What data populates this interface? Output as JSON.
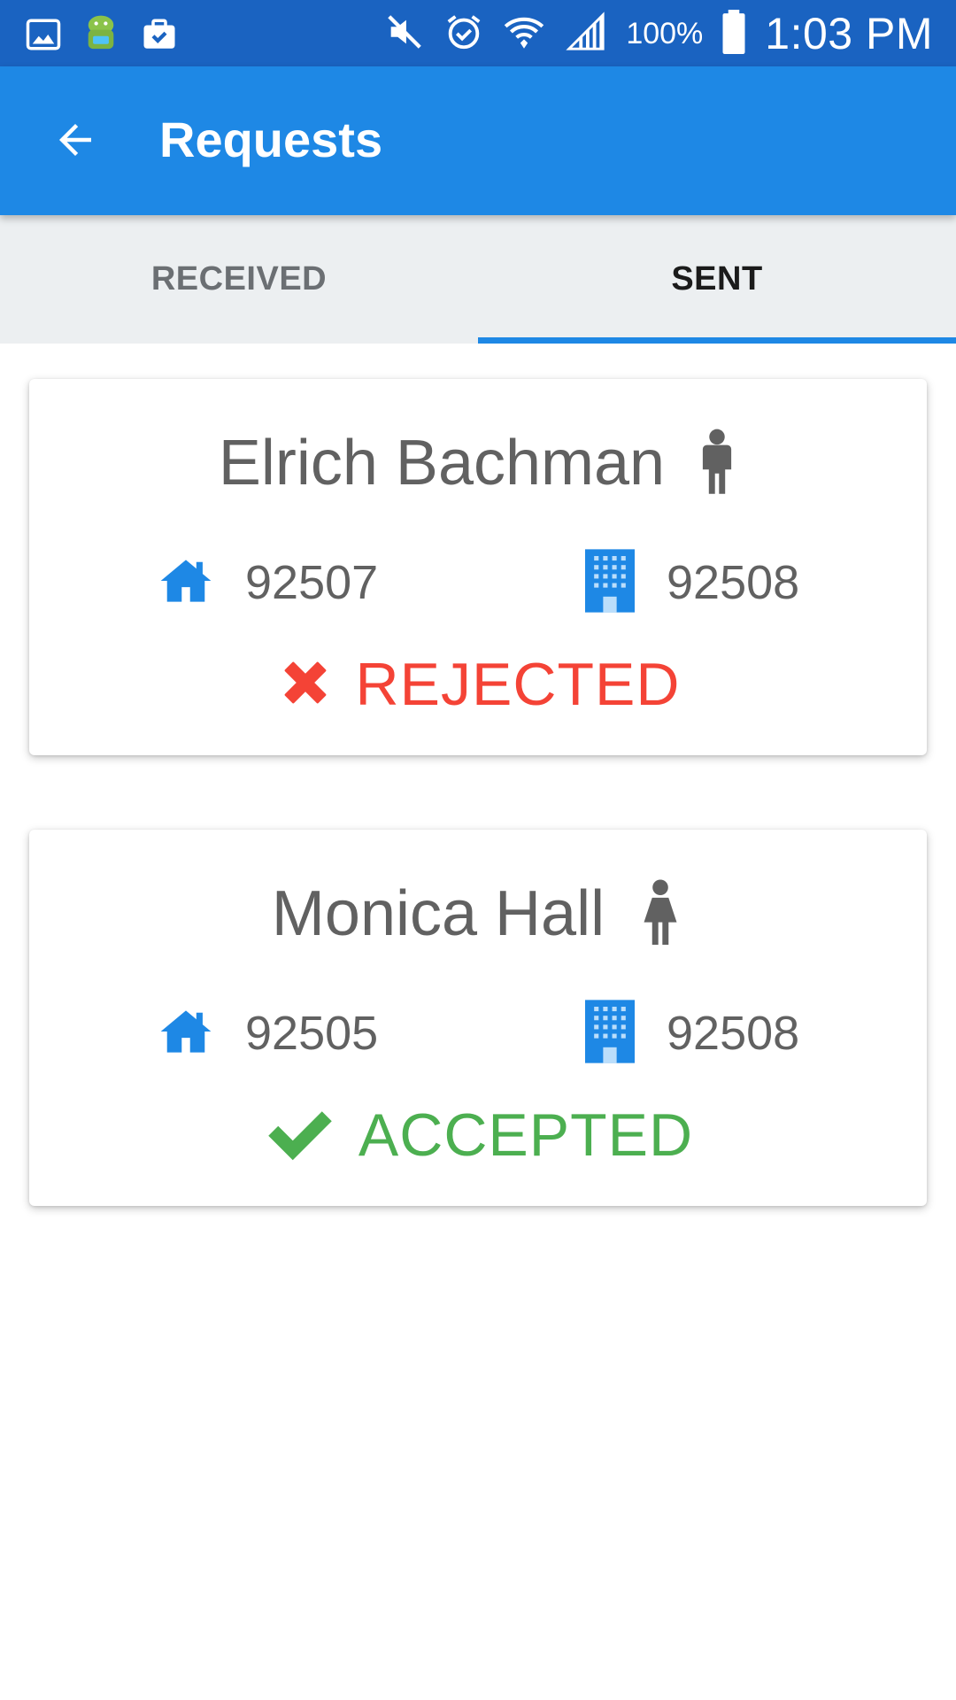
{
  "status_bar": {
    "battery_percent": "100%",
    "time": "1:03 PM",
    "left_icons": [
      "image-icon",
      "android-icon",
      "briefcase-check-icon"
    ],
    "right_icons": [
      "mute-icon",
      "alarm-icon",
      "wifi-icon",
      "signal-icon",
      "battery-icon"
    ]
  },
  "app_bar": {
    "title": "Requests",
    "back_icon": "arrow-back-icon"
  },
  "tabs": [
    {
      "label": "RECEIVED",
      "active": false
    },
    {
      "label": "SENT",
      "active": true
    }
  ],
  "requests": [
    {
      "name": "Elrich Bachman",
      "gender_icon": "male-icon",
      "home_zip": "92507",
      "work_zip": "92508",
      "status": "REJECTED",
      "status_icon": "x-icon",
      "status_color": "#f44336"
    },
    {
      "name": "Monica Hall",
      "gender_icon": "female-icon",
      "home_zip": "92505",
      "work_zip": "92508",
      "status": "ACCEPTED",
      "status_icon": "check-icon",
      "status_color": "#4caf50"
    }
  ],
  "colors": {
    "status_bar": "#1a63c1",
    "app_bar": "#1e88e5",
    "accent": "#1e88e5",
    "tab_bg": "#eceff1",
    "text_gray": "#616161"
  }
}
